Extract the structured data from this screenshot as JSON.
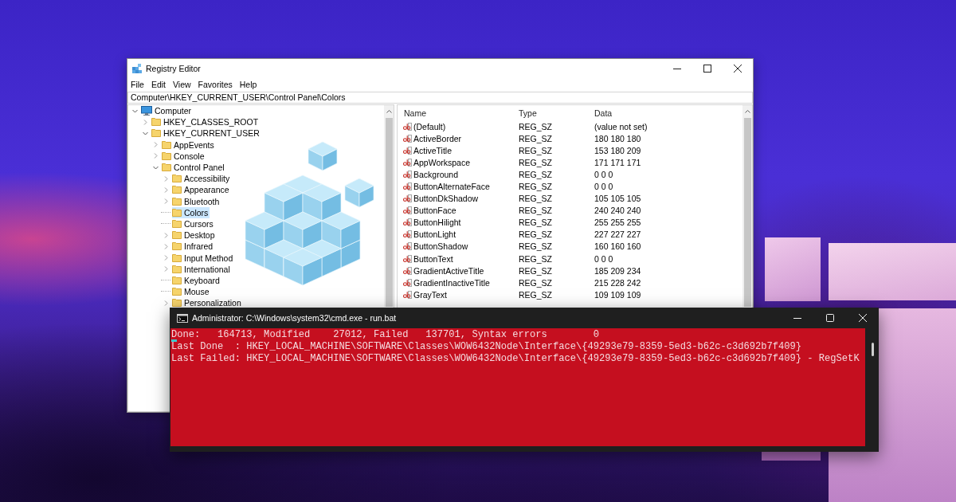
{
  "registry_editor": {
    "title": "Registry Editor",
    "menu": [
      "File",
      "Edit",
      "View",
      "Favorites",
      "Help"
    ],
    "address": "Computer\\HKEY_CURRENT_USER\\Control Panel\\Colors",
    "tree": [
      {
        "label": "Computer",
        "expanded": true,
        "selected": false,
        "children": [
          {
            "label": "HKEY_CLASSES_ROOT",
            "expanded": false,
            "selected": false
          },
          {
            "label": "HKEY_CURRENT_USER",
            "expanded": true,
            "selected": false,
            "children": [
              {
                "label": "AppEvents",
                "expanded": false,
                "selected": false
              },
              {
                "label": "Console",
                "expanded": false,
                "selected": false
              },
              {
                "label": "Control Panel",
                "expanded": true,
                "selected": false,
                "children": [
                  {
                    "label": "Accessibility",
                    "expanded": false,
                    "selected": false
                  },
                  {
                    "label": "Appearance",
                    "expanded": false,
                    "selected": false
                  },
                  {
                    "label": "Bluetooth",
                    "expanded": false,
                    "selected": false
                  },
                  {
                    "label": "Colors",
                    "selected": true
                  },
                  {
                    "label": "Cursors",
                    "selected": false
                  },
                  {
                    "label": "Desktop",
                    "expanded": false,
                    "selected": false
                  },
                  {
                    "label": "Infrared",
                    "expanded": false,
                    "selected": false
                  },
                  {
                    "label": "Input Method",
                    "expanded": false,
                    "selected": false
                  },
                  {
                    "label": "International",
                    "expanded": false,
                    "selected": false
                  },
                  {
                    "label": "Keyboard",
                    "selected": false
                  },
                  {
                    "label": "Mouse",
                    "selected": false
                  },
                  {
                    "label": "Personalization",
                    "expanded": false,
                    "selected": false
                  }
                ]
              }
            ]
          }
        ]
      }
    ],
    "list": {
      "columns": [
        "Name",
        "Type",
        "Data"
      ],
      "rows": [
        {
          "name": "(Default)",
          "type": "REG_SZ",
          "data": "(value not set)",
          "selected": false
        },
        {
          "name": "ActiveBorder",
          "type": "REG_SZ",
          "data": "180 180 180",
          "selected": false
        },
        {
          "name": "ActiveTitle",
          "type": "REG_SZ",
          "data": "153 180 209",
          "selected": false
        },
        {
          "name": "AppWorkspace",
          "type": "REG_SZ",
          "data": "171 171 171",
          "selected": false
        },
        {
          "name": "Background",
          "type": "REG_SZ",
          "data": "0 0 0",
          "selected": false
        },
        {
          "name": "ButtonAlternateFace",
          "type": "REG_SZ",
          "data": "0 0 0",
          "selected": false
        },
        {
          "name": "ButtonDkShadow",
          "type": "REG_SZ",
          "data": "105 105 105",
          "selected": false
        },
        {
          "name": "ButtonFace",
          "type": "REG_SZ",
          "data": "240 240 240",
          "selected": false
        },
        {
          "name": "ButtonHilight",
          "type": "REG_SZ",
          "data": "255 255 255",
          "selected": false
        },
        {
          "name": "ButtonLight",
          "type": "REG_SZ",
          "data": "227 227 227",
          "selected": false
        },
        {
          "name": "ButtonShadow",
          "type": "REG_SZ",
          "data": "160 160 160",
          "selected": false
        },
        {
          "name": "ButtonText",
          "type": "REG_SZ",
          "data": "0 0 0",
          "selected": false
        },
        {
          "name": "GradientActiveTitle",
          "type": "REG_SZ",
          "data": "185 209 234",
          "selected": false
        },
        {
          "name": "GradientInactiveTitle",
          "type": "REG_SZ",
          "data": "215 228 242",
          "selected": false
        },
        {
          "name": "GrayText",
          "type": "REG_SZ",
          "data": "109 109 109",
          "selected": false
        }
      ]
    }
  },
  "console": {
    "title": "Administrator: C:\\Windows\\system32\\cmd.exe - run.bat",
    "lines": [
      "Done:   164713, Modified    27012, Failed   137701, Syntax errors        0",
      "Last Done  : HKEY_LOCAL_MACHINE\\SOFTWARE\\Classes\\WOW6432Node\\Interface\\{49293e79-8359-5ed3-b62c-c3d692b7f409}",
      "Last Failed: HKEY_LOCAL_MACHINE\\SOFTWARE\\Classes\\WOW6432Node\\Interface\\{49293e79-8359-5ed3-b62c-c3d692b7f409} - RegSetK"
    ]
  }
}
